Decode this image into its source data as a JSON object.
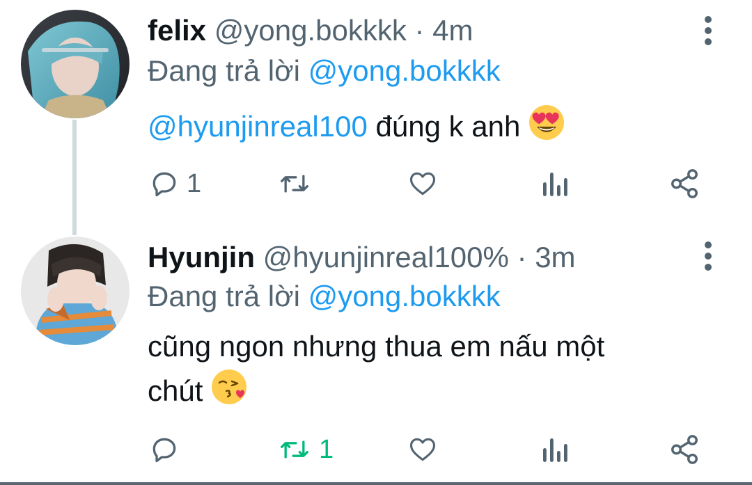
{
  "tweets": [
    {
      "display_name": "felix",
      "handle": "@yong.bokkkk",
      "separator": "·",
      "time": "4m",
      "replying_prefix": "Đang trả lời",
      "replying_to": "@yong.bokkkk",
      "mention": "@hyunjinreal100",
      "text": " đúng k anh",
      "emoji": "heart-eyes",
      "reply_count": "1",
      "retweet_count": "",
      "retweeted": false
    },
    {
      "display_name": "Hyunjin",
      "handle": "@hyunjinreal100%",
      "separator": "·",
      "time": "3m",
      "replying_prefix": "Đang trả lời",
      "replying_to": "@yong.bokkkk",
      "text_line1": "cũng ngon nhưng thua em nấu một",
      "text_line2": "chút",
      "emoji": "kissing-heart",
      "reply_count": "",
      "retweet_count": "1",
      "retweeted": true
    }
  ],
  "colors": {
    "link": "#1d9bf0",
    "muted": "#536471",
    "retweet_active": "#00ba7c",
    "thread_line": "#cfd9de"
  },
  "icons": [
    "reply-icon",
    "retweet-icon",
    "like-icon",
    "analytics-icon",
    "share-icon",
    "more-icon"
  ]
}
